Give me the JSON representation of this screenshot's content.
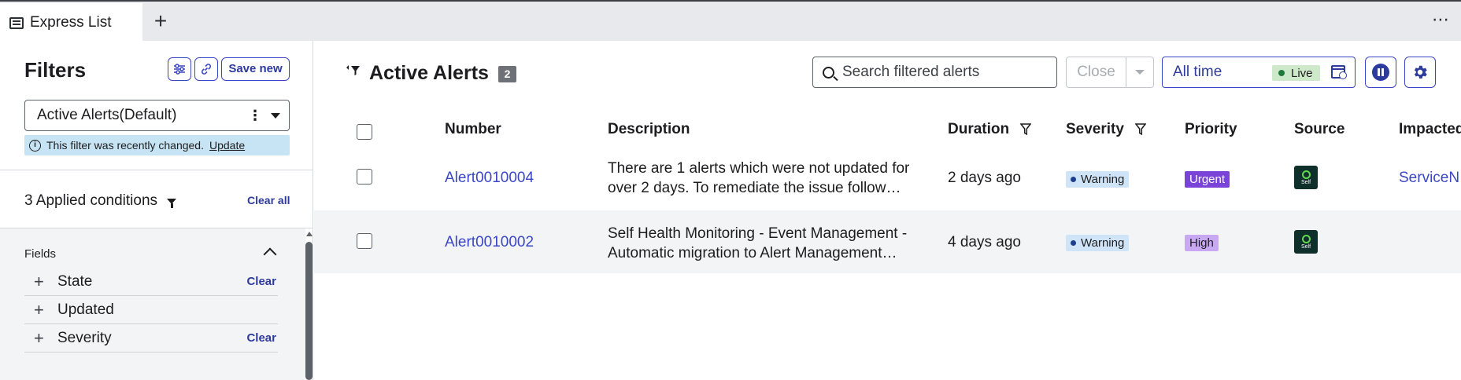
{
  "tabs": {
    "active_label": "Express List",
    "add_label": "+",
    "more_label": "⋯"
  },
  "filters": {
    "title": "Filters",
    "save_new_label": "Save new",
    "selected_filter": "Active Alerts(Default)",
    "notice_text": "This filter was recently changed.",
    "notice_link": "Update",
    "applied_conditions": "3 Applied conditions",
    "clear_all_label": "Clear all",
    "fields_section_title": "Fields",
    "fields": [
      {
        "label": "State",
        "clear_label": "Clear"
      },
      {
        "label": "Updated",
        "clear_label": ""
      },
      {
        "label": "Severity",
        "clear_label": "Clear"
      }
    ]
  },
  "header": {
    "title": "Active Alerts",
    "count": "2",
    "search_placeholder": "Search filtered alerts",
    "close_label": "Close",
    "time_range": "All time",
    "live_label": "Live"
  },
  "table": {
    "columns": [
      "Number",
      "Description",
      "Duration",
      "Severity",
      "Priority",
      "Source",
      "Impacted"
    ],
    "rows": [
      {
        "number": "Alert0010004",
        "description_line1": "There are 1 alerts which were not updated for",
        "description_line2": "over 2 days. To remediate the issue follow…",
        "duration": "2 days ago",
        "severity": "Warning",
        "priority": "Urgent",
        "source_label": "Self",
        "impacted": "ServiceN"
      },
      {
        "number": "Alert0010002",
        "description_line1": "Self Health Monitoring - Event Management -",
        "description_line2": "Automatic migration to Alert Management…",
        "duration": "4 days ago",
        "severity": "Warning",
        "priority": "High",
        "source_label": "Self",
        "impacted": ""
      }
    ]
  },
  "colors": {
    "accent": "#3a46c4",
    "urgent": "#7b44d8",
    "high": "#c9a8f3",
    "warning_bg": "#cfe5f7",
    "live_bg": "#cde9c9"
  }
}
